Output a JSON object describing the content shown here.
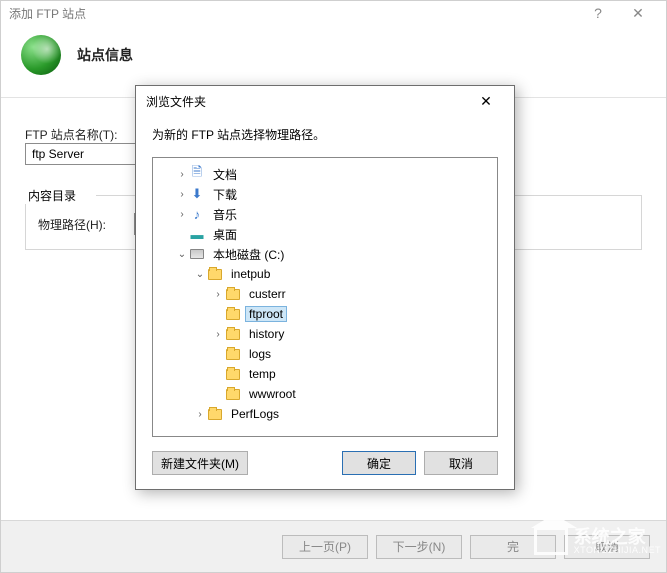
{
  "wizard": {
    "title": "添加 FTP 站点",
    "heading": "站点信息",
    "site_name_label": "FTP 站点名称(T):",
    "site_name_value": "ftp Server",
    "content_group_title": "内容目录",
    "path_label": "物理路径(H):",
    "path_value": "",
    "buttons": {
      "prev": "上一页(P)",
      "next": "下一步(N)",
      "finish": "完",
      "cancel": "取消"
    }
  },
  "dialog": {
    "title": "浏览文件夹",
    "instruction": "为新的 FTP 站点选择物理路径。",
    "buttons": {
      "new_folder": "新建文件夹(M)",
      "ok": "确定",
      "cancel": "取消"
    },
    "tree": [
      {
        "indent": 1,
        "arrow": "right",
        "icon": "doc",
        "label": "文档"
      },
      {
        "indent": 1,
        "arrow": "right",
        "icon": "down",
        "label": "下载"
      },
      {
        "indent": 1,
        "arrow": "right",
        "icon": "music",
        "label": "音乐"
      },
      {
        "indent": 1,
        "arrow": "none",
        "icon": "desk",
        "label": "桌面"
      },
      {
        "indent": 1,
        "arrow": "down",
        "icon": "disk",
        "label": "本地磁盘 (C:)"
      },
      {
        "indent": 2,
        "arrow": "down",
        "icon": "folder",
        "label": "inetpub"
      },
      {
        "indent": 3,
        "arrow": "right",
        "icon": "folder",
        "label": "custerr"
      },
      {
        "indent": 3,
        "arrow": "none",
        "icon": "folder",
        "label": "ftproot",
        "selected": true
      },
      {
        "indent": 3,
        "arrow": "right",
        "icon": "folder",
        "label": "history"
      },
      {
        "indent": 3,
        "arrow": "none",
        "icon": "folder",
        "label": "logs"
      },
      {
        "indent": 3,
        "arrow": "none",
        "icon": "folder",
        "label": "temp"
      },
      {
        "indent": 3,
        "arrow": "none",
        "icon": "folder",
        "label": "wwwroot"
      },
      {
        "indent": 2,
        "arrow": "right",
        "icon": "folder",
        "label": "PerfLogs"
      }
    ]
  },
  "watermark": {
    "text_big": "系统之家",
    "text_small": "XTONGZHIJIA.NET"
  }
}
